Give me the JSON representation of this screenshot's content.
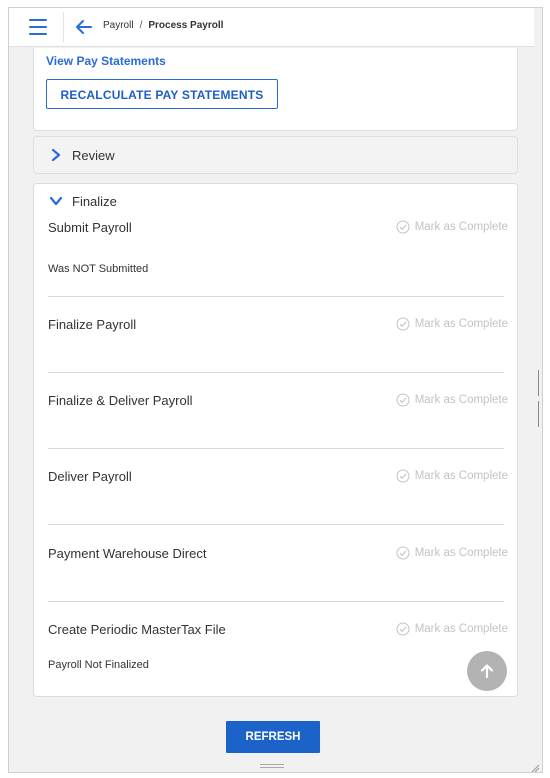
{
  "header": {
    "breadcrumb_root": "Payroll",
    "breadcrumb_sep": "/",
    "breadcrumb_current": "Process Payroll"
  },
  "top_card": {
    "view_link": "View Pay Statements",
    "recalc_button": "RECALCULATE PAY STATEMENTS"
  },
  "review": {
    "label": "Review",
    "state": "collapsed"
  },
  "finalize": {
    "label": "Finalize",
    "state": "expanded",
    "mark_label": "Mark as Complete",
    "steps": [
      {
        "title": "Submit Payroll",
        "status": "Was NOT Submitted"
      },
      {
        "title": "Finalize Payroll",
        "status": ""
      },
      {
        "title": "Finalize & Deliver Payroll",
        "status": ""
      },
      {
        "title": "Deliver Payroll",
        "status": ""
      },
      {
        "title": "Payment Warehouse Direct",
        "status": ""
      },
      {
        "title": "Create Periodic MasterTax File",
        "status": "Payroll Not Finalized"
      }
    ]
  },
  "footer": {
    "refresh_button": "REFRESH"
  },
  "colors": {
    "accent": "#2a6cd6",
    "button_fill": "#1b62c9",
    "muted": "#c3c3c3",
    "fab": "#b3b3b3"
  },
  "icons": [
    "menu-icon",
    "back-arrow-icon",
    "chevron-right-icon",
    "chevron-down-icon",
    "check-circle-icon",
    "arrow-up-icon"
  ]
}
